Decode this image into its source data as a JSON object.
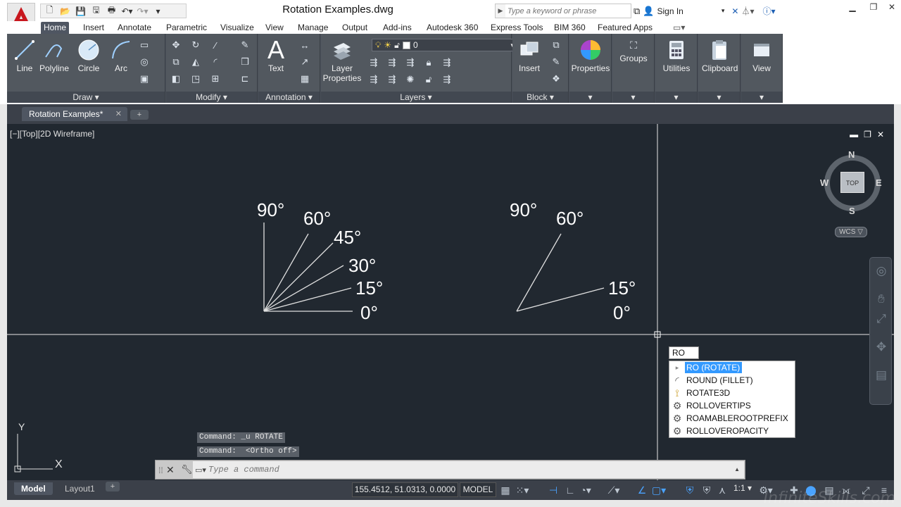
{
  "window": {
    "title": "Rotation Examples.dwg",
    "search_placeholder": "Type a keyword or phrase",
    "signin_label": "Sign In"
  },
  "quick_access": {
    "icons": [
      "new-icon",
      "open-icon",
      "save-icon",
      "saveas-icon",
      "print-icon",
      "undo-icon",
      "redo-icon",
      "customize-icon"
    ]
  },
  "ribbon": {
    "tabs": [
      "Home",
      "Insert",
      "Annotate",
      "Parametric",
      "Visualize",
      "View",
      "Manage",
      "Output",
      "Add-ins",
      "Autodesk 360",
      "Express Tools",
      "BIM 360",
      "Featured Apps"
    ],
    "active_tab": "Home",
    "draw": {
      "title": "Draw",
      "tools": [
        "Line",
        "Polyline",
        "Circle",
        "Arc"
      ]
    },
    "modify": {
      "title": "Modify"
    },
    "annotation": {
      "title": "Annotation",
      "text_label": "Text"
    },
    "layers": {
      "title": "Layers",
      "layer_properties_label": "Layer\nProperties",
      "current_layer": "0"
    },
    "block": {
      "title": "Block",
      "insert_label": "Insert"
    },
    "properties_label": "Properties",
    "groups_label": "Groups",
    "utilities_label": "Utilities",
    "clipboard_label": "Clipboard",
    "view_label": "View"
  },
  "file_tab": {
    "label": "Rotation Examples*"
  },
  "viewport": {
    "label": "[−][Top][2D Wireframe]",
    "viewcube": {
      "north": "N",
      "south": "S",
      "east": "E",
      "west": "W",
      "face": "TOP"
    },
    "wcs_label": "WCS ▽"
  },
  "drawing": {
    "left_group_labels": [
      "90°",
      "60°",
      "45°",
      "30°",
      "15°",
      "0°"
    ],
    "right_group_labels": [
      "90°",
      "60°",
      "15°",
      "0°"
    ],
    "ucs": {
      "x": "X",
      "y": "Y"
    }
  },
  "dynamic_input": {
    "value": "RO",
    "suggestions": [
      {
        "label": "RO (ROTATE)",
        "icon": "rotate-icon",
        "selected": true
      },
      {
        "label": "ROUND (FILLET)",
        "icon": "fillet-icon",
        "selected": false
      },
      {
        "label": "ROTATE3D",
        "icon": "rotate3d-icon",
        "selected": false
      },
      {
        "label": "ROLLOVERTIPS",
        "icon": "gear-icon",
        "selected": false
      },
      {
        "label": "ROAMABLEROOTPREFIX",
        "icon": "gear-icon",
        "selected": false
      },
      {
        "label": "ROLLOVEROPACITY",
        "icon": "gear-icon",
        "selected": false
      }
    ]
  },
  "command": {
    "history": [
      "Command: _u ROTATE",
      "Command:  <Ortho off>"
    ],
    "placeholder": "Type a command"
  },
  "status": {
    "layout_tabs": [
      "Model",
      "Layout1"
    ],
    "coordinates": "155.4512, 51.0313, 0.0000",
    "space": "MODEL",
    "scale": "1:1",
    "watermark": "InfiniteSkills.com"
  }
}
